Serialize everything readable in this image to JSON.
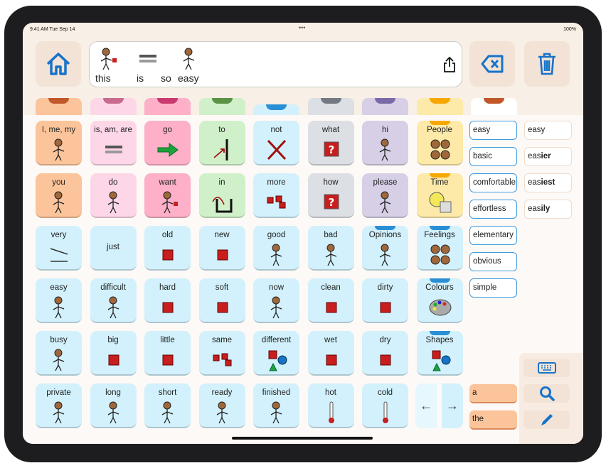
{
  "status": {
    "time": "9:41 AM  Tue Sep 14",
    "dots": "•••",
    "battery": "100%"
  },
  "colors": {
    "orange": "#fcc49a",
    "pink": "#fdd7e8",
    "rose": "#fdb0c8",
    "green": "#d0f0c9",
    "blue": "#d2f1fc",
    "gray": "#dcdfe3",
    "purple": "#d6cfe6",
    "yellow": "#fde9a8",
    "white": "#ffffff",
    "accent": "#1673c9"
  },
  "tabs": [
    {
      "color": "orange",
      "mark": "#c0582a"
    },
    {
      "color": "pink",
      "mark": "#c96a8f"
    },
    {
      "color": "rose",
      "mark": "#c93a70"
    },
    {
      "color": "green",
      "mark": "#5a9346"
    },
    {
      "color": "blue",
      "mark": "#2b8fd6"
    },
    {
      "color": "gray",
      "mark": "#737a84"
    },
    {
      "color": "purple",
      "mark": "#7a6aa8"
    },
    {
      "color": "yellow",
      "mark": "#f7a800"
    },
    {
      "color": "white",
      "mark": "#c0582a"
    }
  ],
  "message": {
    "words": [
      {
        "text": "this",
        "icon": "point"
      },
      {
        "text": "is",
        "icon": "equals"
      },
      {
        "text": "so",
        "icon": ""
      },
      {
        "text": "easy",
        "icon": "person"
      }
    ]
  },
  "grid": [
    [
      {
        "label": "I, me, my",
        "color": "orange",
        "icon": "person"
      },
      {
        "label": "is, am, are",
        "color": "pink",
        "icon": "equals"
      },
      {
        "label": "go",
        "color": "rose",
        "icon": "arrow"
      },
      {
        "label": "to",
        "color": "green",
        "icon": "to"
      },
      {
        "label": "not",
        "color": "blue",
        "icon": "cross"
      },
      {
        "label": "what",
        "color": "gray",
        "icon": "question"
      },
      {
        "label": "hi",
        "color": "purple",
        "icon": "person"
      },
      {
        "label": "People",
        "color": "yellow",
        "icon": "faces",
        "category": true
      }
    ],
    [
      {
        "label": "you",
        "color": "orange",
        "icon": "person"
      },
      {
        "label": "do",
        "color": "pink",
        "icon": "person"
      },
      {
        "label": "want",
        "color": "rose",
        "icon": "point"
      },
      {
        "label": "in",
        "color": "green",
        "icon": "in"
      },
      {
        "label": "more",
        "color": "blue",
        "icon": "squares"
      },
      {
        "label": "how",
        "color": "gray",
        "icon": "question"
      },
      {
        "label": "please",
        "color": "purple",
        "icon": "person"
      },
      {
        "label": "Time",
        "color": "yellow",
        "icon": "clock",
        "category": true
      }
    ],
    [
      {
        "label": "very",
        "color": "blue",
        "icon": "lines"
      },
      {
        "label": "just",
        "color": "blue",
        "icon": ""
      },
      {
        "label": "old",
        "color": "blue",
        "icon": "square"
      },
      {
        "label": "new",
        "color": "blue",
        "icon": "square"
      },
      {
        "label": "good",
        "color": "blue",
        "icon": "person"
      },
      {
        "label": "bad",
        "color": "blue",
        "icon": "person"
      },
      {
        "label": "Opinions",
        "color": "blue",
        "icon": "person",
        "category": true
      },
      {
        "label": "Feelings",
        "color": "blue",
        "icon": "faces",
        "category": true
      }
    ],
    [
      {
        "label": "easy",
        "color": "blue",
        "icon": "person"
      },
      {
        "label": "difficult",
        "color": "blue",
        "icon": "person"
      },
      {
        "label": "hard",
        "color": "blue",
        "icon": "square"
      },
      {
        "label": "soft",
        "color": "blue",
        "icon": "square"
      },
      {
        "label": "now",
        "color": "blue",
        "icon": "person"
      },
      {
        "label": "clean",
        "color": "blue",
        "icon": "square"
      },
      {
        "label": "dirty",
        "color": "blue",
        "icon": "square"
      },
      {
        "label": "Colours",
        "color": "blue",
        "icon": "palette",
        "category": true
      }
    ],
    [
      {
        "label": "busy",
        "color": "blue",
        "icon": "person"
      },
      {
        "label": "big",
        "color": "blue",
        "icon": "square"
      },
      {
        "label": "little",
        "color": "blue",
        "icon": "square"
      },
      {
        "label": "same",
        "color": "blue",
        "icon": "squares"
      },
      {
        "label": "different",
        "color": "blue",
        "icon": "shapes"
      },
      {
        "label": "wet",
        "color": "blue",
        "icon": "square"
      },
      {
        "label": "dry",
        "color": "blue",
        "icon": "square"
      },
      {
        "label": "Shapes",
        "color": "blue",
        "icon": "shapes",
        "category": true
      }
    ],
    [
      {
        "label": "private",
        "color": "blue",
        "icon": "person"
      },
      {
        "label": "long",
        "color": "blue",
        "icon": "person"
      },
      {
        "label": "short",
        "color": "blue",
        "icon": "person"
      },
      {
        "label": "ready",
        "color": "blue",
        "icon": "person"
      },
      {
        "label": "finished",
        "color": "blue",
        "icon": "person"
      },
      {
        "label": "hot",
        "color": "blue",
        "icon": "thermo"
      },
      {
        "label": "cold",
        "color": "blue",
        "icon": "thermo"
      }
    ]
  ],
  "nav": {
    "back": "←",
    "forward": "→"
  },
  "synonyms": [
    "easy",
    "basic",
    "comfortable",
    "effortless",
    "elementary",
    "obvious",
    "simple"
  ],
  "word_forms": [
    {
      "base": "eas",
      "suffix": "y"
    },
    {
      "base": "eas",
      "suffix": "ier"
    },
    {
      "base": "eas",
      "suffix": "iest"
    },
    {
      "base": "eas",
      "suffix": "ily"
    }
  ],
  "determiners": [
    "a",
    "the"
  ],
  "tools": [
    "keyboard-icon",
    "search-icon",
    "pencil-icon"
  ]
}
